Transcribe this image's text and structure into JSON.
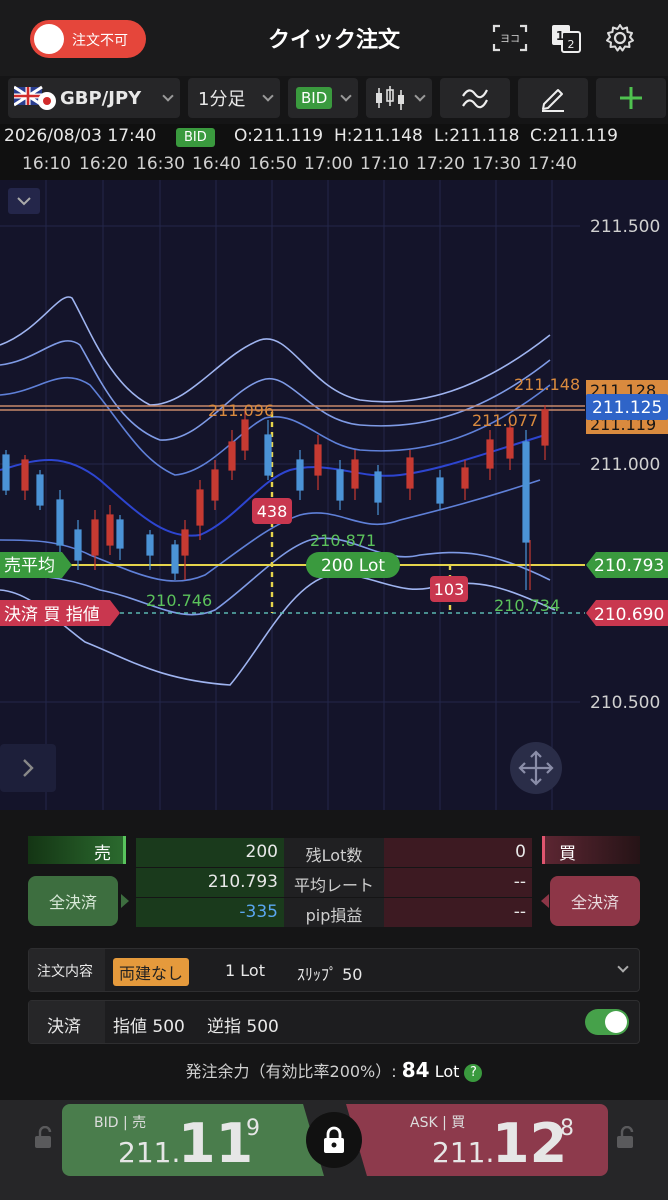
{
  "header": {
    "order_toggle_label": "注文不可",
    "title": "クイック注文",
    "icons": [
      "keyboard-icon",
      "one-two-icon",
      "gear-icon"
    ],
    "screen_label": "ヨコ",
    "layout_label_1": "1",
    "layout_label_2": "2"
  },
  "toolbar": {
    "symbol": "GBP/JPY",
    "timeframe": "1分足",
    "price_type": "BID"
  },
  "ohlc": {
    "datetime": "2026/08/03 17:40",
    "price_type": "BID",
    "open": "O:211.119",
    "high": "H:211.148",
    "low": "L:211.118",
    "close": "C:211.119"
  },
  "time_axis": [
    "16:10",
    "16:20",
    "16:30",
    "16:40",
    "16:50",
    "17:00",
    "17:10",
    "17:20",
    "17:30",
    "17:40"
  ],
  "chart": {
    "price_labels": [
      "211.500",
      "211.000",
      "210.500"
    ],
    "label_high": "211.148",
    "label_211128": "211.128",
    "label_current": "211.125",
    "label_211119": "211.119",
    "label_peak_left": "211.096",
    "label_peak_right": "211.077",
    "label_low_mid": "210.871",
    "label_low_left": "210.746",
    "label_low_right": "210.734",
    "sell_avg_label": "売平均",
    "sell_avg_price": "210.793",
    "lot_label": "200 Lot",
    "settle_label": "決済 買 指値",
    "settle_price": "210.690",
    "marker_438": "438",
    "marker_103": "103"
  },
  "position": {
    "sell_header": "売",
    "buy_header": "買",
    "close_all_sell": "全決済",
    "close_all_buy": "全決済",
    "rows": [
      {
        "label": "残Lot数",
        "sell": "200",
        "buy": "0"
      },
      {
        "label": "平均レート",
        "sell": "210.793",
        "buy": "--"
      },
      {
        "label": "pip損益",
        "sell": "-335",
        "buy": "--"
      }
    ]
  },
  "order": {
    "label": "注文内容",
    "hedge": "両建なし",
    "lot": "1 Lot",
    "slip": "ｽﾘｯﾌﾟ 50"
  },
  "settle": {
    "label": "決済",
    "limit": "指値 500",
    "stop": "逆指 500",
    "enabled": true
  },
  "margin": {
    "label": "発注余力（有効比率200%）:",
    "value": "84",
    "unit": "Lot"
  },
  "trade": {
    "bid_label": "BID | 売",
    "bid_prefix": "211.",
    "bid_main": "11",
    "bid_sup": "9",
    "ask_label": "ASK | 買",
    "ask_prefix": "211.",
    "ask_main": "12",
    "ask_sup": "8"
  },
  "colors": {
    "accent_green": "#3a9a3e",
    "accent_red": "#c9374f",
    "candle_up": "#c63a32",
    "candle_down": "#4b93d6",
    "avg_line": "#e5d44c"
  }
}
